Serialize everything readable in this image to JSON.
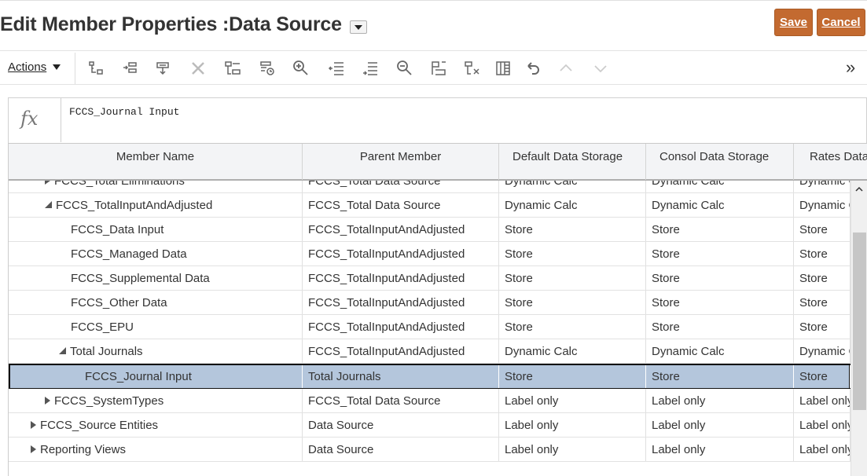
{
  "header": {
    "title": "Edit Member Properties :Data Source",
    "save_label": "Save",
    "cancel_label": "Cancel"
  },
  "toolbar": {
    "actions_label": "Actions",
    "icons": [
      "add-child-icon",
      "add-sibling-icon",
      "edit-member-icon",
      "delete-icon",
      "move-member-icon",
      "refresh-member-icon",
      "zoom-in-icon",
      "collapse-icon",
      "expand-icon",
      "zoom-out-icon",
      "go-to-icon",
      "remove-icon",
      "column-layout-icon",
      "undo-icon",
      "move-up-icon",
      "move-down-icon"
    ],
    "overflow_label": "»"
  },
  "formula": {
    "fx_label": "fx",
    "value": "FCCS_Journal Input"
  },
  "grid": {
    "columns": [
      "Member Name",
      "Parent Member",
      "Default Data Storage",
      "Consol Data Storage",
      "Rates Data"
    ],
    "rows": [
      {
        "member": "FCCS_Total Eliminations",
        "parent": "FCCS_Total Data Source",
        "default": "Dynamic Calc",
        "consol": "Dynamic Calc",
        "rates": "Dynamic Calc",
        "level": 1,
        "state": "collapsed",
        "partial": true
      },
      {
        "member": "FCCS_TotalInputAndAdjusted",
        "parent": "FCCS_Total Data Source",
        "default": "Dynamic Calc",
        "consol": "Dynamic Calc",
        "rates": "Dynamic Calc",
        "level": 1,
        "state": "expanded"
      },
      {
        "member": "FCCS_Data Input",
        "parent": "FCCS_TotalInputAndAdjusted",
        "default": "Store",
        "consol": "Store",
        "rates": "Store",
        "level": 2,
        "state": "leaf"
      },
      {
        "member": "FCCS_Managed Data",
        "parent": "FCCS_TotalInputAndAdjusted",
        "default": "Store",
        "consol": "Store",
        "rates": "Store",
        "level": 2,
        "state": "leaf"
      },
      {
        "member": "FCCS_Supplemental Data",
        "parent": "FCCS_TotalInputAndAdjusted",
        "default": "Store",
        "consol": "Store",
        "rates": "Store",
        "level": 2,
        "state": "leaf"
      },
      {
        "member": "FCCS_Other Data",
        "parent": "FCCS_TotalInputAndAdjusted",
        "default": "Store",
        "consol": "Store",
        "rates": "Store",
        "level": 2,
        "state": "leaf"
      },
      {
        "member": "FCCS_EPU",
        "parent": "FCCS_TotalInputAndAdjusted",
        "default": "Store",
        "consol": "Store",
        "rates": "Store",
        "level": 2,
        "state": "leaf"
      },
      {
        "member": "Total Journals",
        "parent": "FCCS_TotalInputAndAdjusted",
        "default": "Dynamic Calc",
        "consol": "Dynamic Calc",
        "rates": "Dynamic Calc",
        "level": 2,
        "state": "expanded"
      },
      {
        "member": "FCCS_Journal Input",
        "parent": "Total Journals",
        "default": "Store",
        "consol": "Store",
        "rates": "Store",
        "level": 3,
        "state": "leaf",
        "selected": true
      },
      {
        "member": "FCCS_SystemTypes",
        "parent": "FCCS_Total Data Source",
        "default": "Label only",
        "consol": "Label only",
        "rates": "Label only",
        "level": 1,
        "state": "collapsed"
      },
      {
        "member": "FCCS_Source Entities",
        "parent": "Data Source",
        "default": "Label only",
        "consol": "Label only",
        "rates": "Label only",
        "level": 0,
        "state": "collapsed"
      },
      {
        "member": "Reporting Views",
        "parent": "Data Source",
        "default": "Label only",
        "consol": "Label only",
        "rates": "Label only",
        "level": 0,
        "state": "collapsed"
      }
    ]
  },
  "colors": {
    "accent": "#c36a30",
    "selected_row": "#b4c6dc"
  }
}
